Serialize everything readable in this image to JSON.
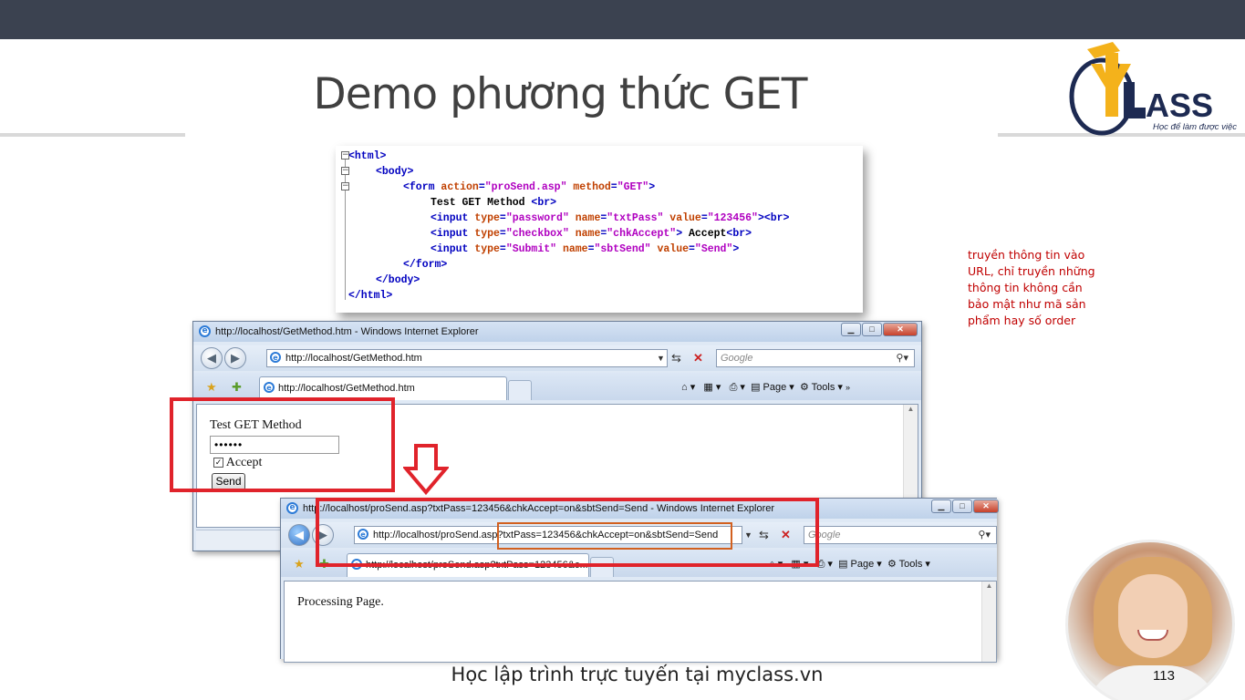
{
  "slide": {
    "title": "Demo phương thức GET",
    "footer": "Học lập trình trực tuyến tại myclass.vn",
    "page_number": "113",
    "note": "truyền thông tin vào URL, chỉ truyền những thông tin không cần bảo mật như mã sản phẩm hay số order"
  },
  "logo": {
    "brand": "MYCLASS",
    "tagline": "Học để làm được việc"
  },
  "code": {
    "lines": [
      {
        "indent": 0,
        "parts": [
          [
            "tg",
            "<html>"
          ]
        ]
      },
      {
        "indent": 4,
        "parts": [
          [
            "tg",
            "<body>"
          ]
        ]
      },
      {
        "indent": 8,
        "parts": [
          [
            "tg",
            "<form "
          ],
          [
            "at",
            "action"
          ],
          [
            "tg",
            "="
          ],
          [
            "vl",
            "\"proSend.asp\""
          ],
          [
            "tg",
            " "
          ],
          [
            "at",
            "method"
          ],
          [
            "tg",
            "="
          ],
          [
            "vl",
            "\"GET\""
          ],
          [
            "tg",
            ">"
          ]
        ]
      },
      {
        "indent": 12,
        "parts": [
          [
            "tx",
            "Test GET Method "
          ],
          [
            "tg",
            "<br>"
          ]
        ]
      },
      {
        "indent": 12,
        "parts": [
          [
            "tg",
            "<input "
          ],
          [
            "at",
            "type"
          ],
          [
            "tg",
            "="
          ],
          [
            "vl",
            "\"password\""
          ],
          [
            "tg",
            " "
          ],
          [
            "at",
            "name"
          ],
          [
            "tg",
            "="
          ],
          [
            "vl",
            "\"txtPass\""
          ],
          [
            "tg",
            " "
          ],
          [
            "at",
            "value"
          ],
          [
            "tg",
            "="
          ],
          [
            "vl",
            "\"123456\""
          ],
          [
            "tg",
            "><br>"
          ]
        ]
      },
      {
        "indent": 12,
        "parts": [
          [
            "tg",
            "<input "
          ],
          [
            "at",
            "type"
          ],
          [
            "tg",
            "="
          ],
          [
            "vl",
            "\"checkbox\""
          ],
          [
            "tg",
            " "
          ],
          [
            "at",
            "name"
          ],
          [
            "tg",
            "="
          ],
          [
            "vl",
            "\"chkAccept\""
          ],
          [
            "tg",
            "> "
          ],
          [
            "tx",
            "Accept"
          ],
          [
            "tg",
            "<br>"
          ]
        ]
      },
      {
        "indent": 12,
        "parts": [
          [
            "tg",
            "<input "
          ],
          [
            "at",
            "type"
          ],
          [
            "tg",
            "="
          ],
          [
            "vl",
            "\"Submit\""
          ],
          [
            "tg",
            " "
          ],
          [
            "at",
            "name"
          ],
          [
            "tg",
            "="
          ],
          [
            "vl",
            "\"sbtSend\""
          ],
          [
            "tg",
            " "
          ],
          [
            "at",
            "value"
          ],
          [
            "tg",
            "="
          ],
          [
            "vl",
            "\"Send\""
          ],
          [
            "tg",
            ">"
          ]
        ]
      },
      {
        "indent": 8,
        "parts": [
          [
            "tg",
            "</form>"
          ]
        ]
      },
      {
        "indent": 4,
        "parts": [
          [
            "tg",
            "</body>"
          ]
        ]
      },
      {
        "indent": 0,
        "parts": [
          [
            "tg",
            "</html>"
          ]
        ]
      }
    ]
  },
  "window1": {
    "title": "http://localhost/GetMethod.htm - Windows Internet Explorer",
    "address": "http://localhost/GetMethod.htm",
    "search_placeholder": "Google",
    "tab_label": "http://localhost/GetMethod.htm",
    "page_label": "Page",
    "tools_label": "Tools",
    "form_heading": "Test GET Method",
    "password_mask": "••••••",
    "checkbox_label": "Accept",
    "submit_label": "Send"
  },
  "window2": {
    "title": "http://localhost/proSend.asp?txtPass=123456&chkAccept=on&sbtSend=Send - Windows Internet Explorer",
    "address_base": "http://localhost/proSend.asp",
    "address_query": "?txtPass=123456&chkAccept=on&sbtSend=Send",
    "search_placeholder": "Google",
    "tab_label": "http://localhost/proSend.asp?txtPass=123456&c...",
    "page_label": "Page",
    "tools_label": "Tools",
    "body_text": "Processing Page."
  },
  "colors": {
    "topbar": "#3b4250",
    "highlight_red": "#e0232b",
    "highlight_orange": "#d2601f",
    "note_red": "#c00000",
    "tag_blue": "#0000c0",
    "attr_orange": "#c04000",
    "value_purple": "#b000c0"
  }
}
